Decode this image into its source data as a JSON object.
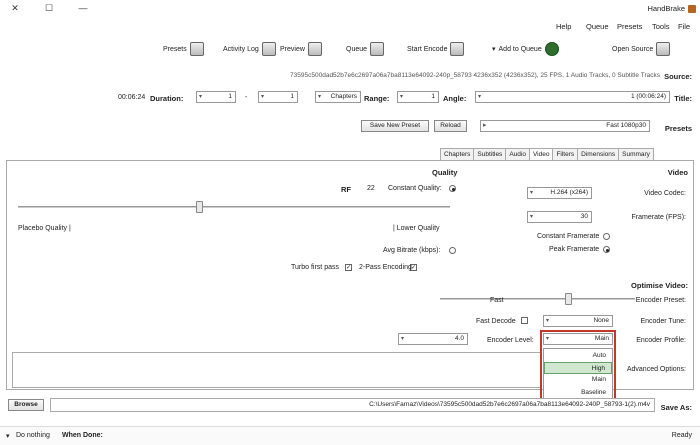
{
  "window": {
    "title": "HandBrake",
    "minimize": "—",
    "maximize": "☐",
    "close": "✕"
  },
  "menu": [
    "File",
    "Tools",
    "Presets",
    "Queue",
    "Help"
  ],
  "toolbar": {
    "open_source": "Open Source",
    "add_to_queue": "Add to Queue",
    "add_to_queue_arrow": "▾",
    "start_encode": "Start Encode",
    "queue": "Queue",
    "preview": "Preview",
    "activity_log": "Activity Log",
    "presets": "Presets"
  },
  "source": {
    "label": "Source:",
    "value": "73595c500dad52b7e6c2697a06a7ba8113e64092-240p_58793 4236x352 (4236x352), 25 FPS, 1 Audio Tracks, 0 Subtitle Tracks"
  },
  "title": {
    "label": "Title:",
    "value": "1 (00:06:24)",
    "angle_label": "Angle:",
    "angle_value": "1",
    "range_label": "Range:",
    "range_type": "Chapters",
    "range_start": "1",
    "range_sep": "-",
    "range_end": "1",
    "duration_label": "Duration:",
    "duration_value": "00:06:24"
  },
  "presets": {
    "label": "Presets",
    "value": "Fast 1080p30",
    "reload": "Reload",
    "save_new": "Save New Preset"
  },
  "tabs": [
    "Summary",
    "Dimensions",
    "Filters",
    "Video",
    "Audio",
    "Subtitles",
    "Chapters"
  ],
  "video": {
    "heading": "Video",
    "codec_label": "Video Codec:",
    "codec_value": "H.264 (x264)",
    "framerate_label": "Framerate (FPS):",
    "framerate_value": "30",
    "constant_framerate": "Constant Framerate",
    "peak_framerate": "Peak Framerate"
  },
  "quality": {
    "heading": "Quality",
    "constant_quality": "Constant Quality:",
    "cq_value": "22",
    "rf": "RF",
    "placebo": "Placebo Quality |",
    "lower": "| Lower Quality",
    "avg_bitrate": "Avg Bitrate (kbps):",
    "two_pass": "2-Pass Encoding",
    "turbo": "Turbo first pass"
  },
  "optimise": {
    "heading": "Optimise Video:",
    "preset_label": "Encoder Preset:",
    "preset_value": "Fast",
    "tune_label": "Encoder Tune:",
    "tune_value": "None",
    "fast_decode": "Fast Decode",
    "profile_label": "Encoder Profile:",
    "profile_value": "Main",
    "level_label": "Encoder Level:",
    "level_value": "4.0",
    "advanced_label": "Advanced Options:"
  },
  "profile_dropdown": [
    "Auto",
    "High",
    "Main",
    "Baseline"
  ],
  "save_as": {
    "label": "Save As:",
    "value": "C:\\Users\\Farnaz\\Videos\\73595c500dad52b7e6c2697a06a7ba8113e64092-240P_58793-1(2).m4v",
    "browse": "Browse"
  },
  "status": {
    "ready": "Ready",
    "when_done_label": "When Done:",
    "when_done_value": "Do nothing",
    "when_done_arrow": "▾"
  },
  "colors": {
    "highlight": "#cfe8cf",
    "outline": "#c0392b",
    "start_green": "#2d6e2d"
  }
}
